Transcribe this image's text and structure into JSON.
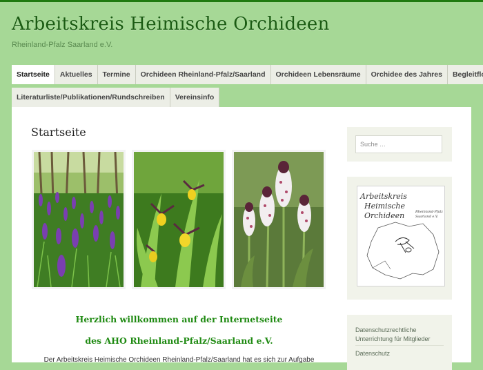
{
  "site": {
    "title": "Arbeitskreis Heimische Orchideen",
    "description": "Rheinland-Pfalz Saarland e.V."
  },
  "nav": {
    "row1": [
      "Startseite",
      "Aktuelles",
      "Termine",
      "Orchideen Rheinland-Pfalz/Saarland",
      "Orchideen Lebensräume",
      "Orchidee des Jahres",
      "Begleitflora"
    ],
    "row2": [
      "Literaturliste/Publikationen/Rundschreiben",
      "Vereinsinfo"
    ]
  },
  "page": {
    "title": "Startseite",
    "welcome_line1": "Herzlich willkommen auf der Internetseite",
    "welcome_line2": "des AHO Rheinland-Pfalz/Saarland e.V.",
    "intro": "Der Arbeitskreis Heimische Orchideen Rheinland-Pfalz/Saarland hat es sich zur Aufgabe"
  },
  "sidebar": {
    "search_placeholder": "Suche …",
    "logo": {
      "line1": "Arbeitskreis",
      "line2": "Heimische",
      "line3": "Orchideen",
      "sub1": "Rheinland-Pfalz",
      "sub2": "Saarland e.V."
    },
    "links": [
      "Datenschutzrechtliche Unterrichtung für Mitglieder",
      "Datenschutz"
    ]
  },
  "colors": {
    "background": "#a6d896",
    "title": "#1a5b12",
    "welcome": "#1f8a12"
  }
}
